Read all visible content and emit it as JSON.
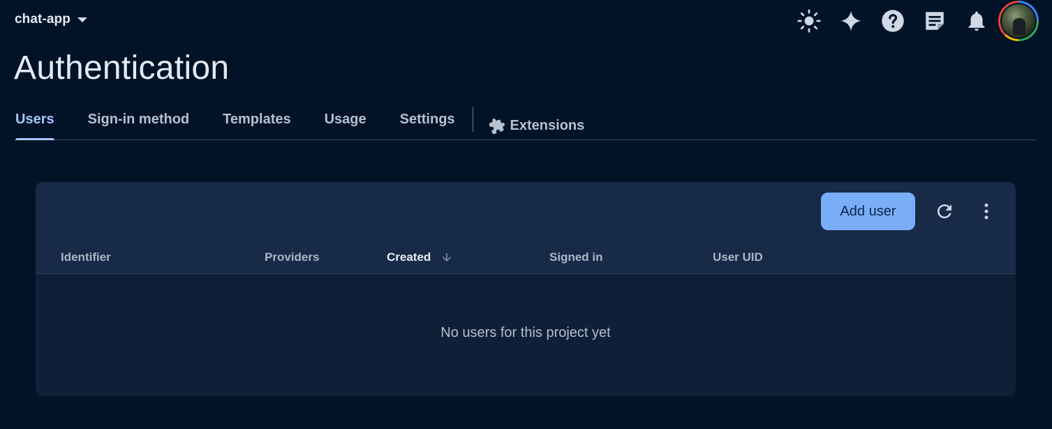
{
  "topbar": {
    "project_name": "chat-app",
    "icons": [
      "sun-icon",
      "sparkle-icon",
      "help-icon",
      "feedback-icon",
      "bell-icon",
      "avatar"
    ],
    "avatar_ring_colors": [
      "#4285f4",
      "#34a853",
      "#fbbc05",
      "#ea4335"
    ]
  },
  "page": {
    "title": "Authentication"
  },
  "tabs": [
    {
      "label": "Users",
      "active": true
    },
    {
      "label": "Sign-in method",
      "active": false
    },
    {
      "label": "Templates",
      "active": false
    },
    {
      "label": "Usage",
      "active": false
    },
    {
      "label": "Settings",
      "active": false
    },
    {
      "label": "Extensions",
      "active": false,
      "icon": "puzzle-icon"
    }
  ],
  "users_table": {
    "add_user_label": "Add user",
    "columns": [
      {
        "label": "Identifier",
        "sorted": false
      },
      {
        "label": "Providers",
        "sorted": false
      },
      {
        "label": "Created",
        "sorted": true,
        "sort_direction": "descending"
      },
      {
        "label": "Signed in",
        "sorted": false
      },
      {
        "label": "User UID",
        "sorted": false
      }
    ],
    "rows": [],
    "empty_message": "No users for this project yet"
  },
  "colors": {
    "background": "#021327",
    "accent": "#a8c7fa",
    "primary_button": "#79aef7",
    "card_header": "#172a47",
    "card_body": "#0f1f38"
  }
}
